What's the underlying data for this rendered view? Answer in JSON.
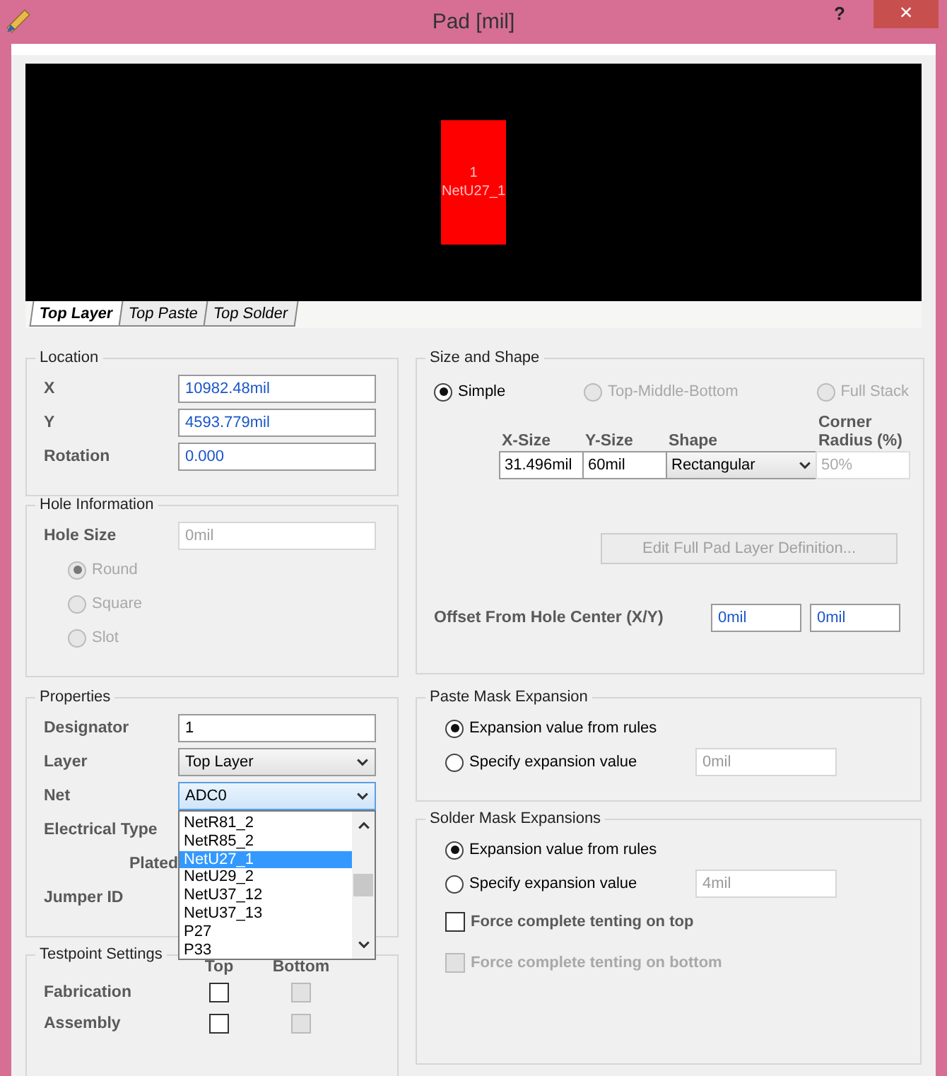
{
  "window": {
    "title": "Pad [mil]",
    "help": "?",
    "close": "×"
  },
  "preview": {
    "designator": "1",
    "net": "NetU27_1"
  },
  "layer_tabs": [
    {
      "label": "Top Layer",
      "selected": true
    },
    {
      "label": "Top Paste",
      "selected": false
    },
    {
      "label": "Top Solder",
      "selected": false
    }
  ],
  "location": {
    "title": "Location",
    "fields": [
      {
        "label": "X",
        "value": "10982.48mil"
      },
      {
        "label": "Y",
        "value": "4593.779mil"
      },
      {
        "label": "Rotation",
        "value": "0.000"
      }
    ]
  },
  "hole_information": {
    "title": "Hole Information",
    "disabled": true,
    "hole_size": {
      "label": "Hole Size",
      "value": "0mil"
    },
    "shapes": [
      {
        "label": "Round",
        "selected": true
      },
      {
        "label": "Square",
        "selected": false
      },
      {
        "label": "Slot",
        "selected": false
      }
    ]
  },
  "properties": {
    "title": "Properties",
    "designator": {
      "label": "Designator",
      "value": "1"
    },
    "layer": {
      "label": "Layer",
      "value": "Top Layer"
    },
    "net": {
      "label": "Net",
      "value": "ADC0",
      "options": [
        {
          "label": "NetR81_2",
          "selected": false
        },
        {
          "label": "NetR85_2",
          "selected": false
        },
        {
          "label": "NetU27_1",
          "selected": true
        },
        {
          "label": "NetU29_2",
          "selected": false
        },
        {
          "label": "NetU37_12",
          "selected": false
        },
        {
          "label": "NetU37_13",
          "selected": false
        },
        {
          "label": "P27",
          "selected": false
        },
        {
          "label": "P33",
          "selected": false
        }
      ]
    },
    "electrical_type": {
      "label": "Electrical Type"
    },
    "plated": {
      "label": "Plated"
    },
    "jumper_id": {
      "label": "Jumper ID"
    }
  },
  "testpoint_settings": {
    "title": "Testpoint Settings",
    "columns": [
      "Top",
      "Bottom"
    ],
    "rows": [
      {
        "label": "Fabrication",
        "top": {
          "checked": false,
          "disabled": false
        },
        "bottom": {
          "checked": false,
          "disabled": true
        }
      },
      {
        "label": "Assembly",
        "top": {
          "checked": false,
          "disabled": false
        },
        "bottom": {
          "checked": false,
          "disabled": true
        }
      }
    ]
  },
  "size_and_shape": {
    "title": "Size and Shape",
    "modes": [
      {
        "label": "Simple",
        "selected": true,
        "disabled": false
      },
      {
        "label": "Top-Middle-Bottom",
        "selected": false,
        "disabled": true
      },
      {
        "label": "Full Stack",
        "selected": false,
        "disabled": true
      }
    ],
    "columns": [
      "X-Size",
      "Y-Size",
      "Shape",
      "Corner Radius (%)"
    ],
    "x_size": "31.496mil",
    "y_size": "60mil",
    "shape": "Rectangular",
    "corner_radius": "50%",
    "edit_button": {
      "label": "Edit Full Pad Layer Definition...",
      "disabled": true
    },
    "offset": {
      "label": "Offset From Hole Center (X/Y)",
      "x": "0mil",
      "y": "0mil"
    }
  },
  "paste_mask_expansion": {
    "title": "Paste Mask Expansion",
    "options": [
      {
        "label": "Expansion value from rules",
        "selected": true
      },
      {
        "label": "Specify expansion value",
        "selected": false
      }
    ],
    "value": "0mil"
  },
  "solder_mask_expansions": {
    "title": "Solder Mask Expansions",
    "options": [
      {
        "label": "Expansion value from rules",
        "selected": true
      },
      {
        "label": "Specify expansion value",
        "selected": false
      }
    ],
    "value": "4mil",
    "checkboxes": [
      {
        "label": "Force complete tenting on top",
        "checked": false,
        "disabled": false
      },
      {
        "label": "Force complete tenting on bottom",
        "checked": false,
        "disabled": true
      }
    ]
  }
}
